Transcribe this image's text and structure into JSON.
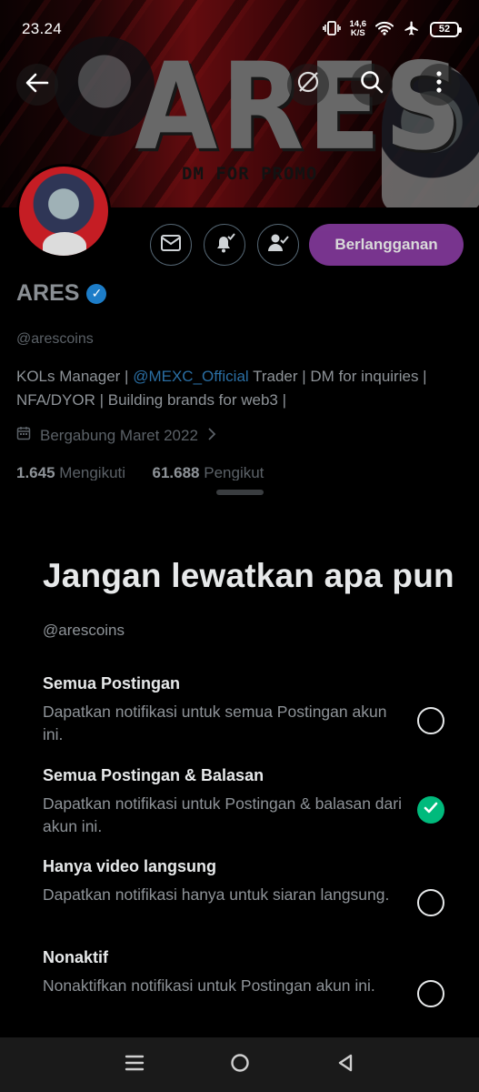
{
  "status_bar": {
    "time": "23.24",
    "net_speed_value": "14,6",
    "net_speed_unit": "K/S",
    "battery": "52"
  },
  "banner": {
    "title": "ARES",
    "subtitle": "DM FOR PROMO"
  },
  "profile": {
    "name": "ARES",
    "handle": "@arescoins",
    "bio_prefix": "KOLs Manager | ",
    "bio_mention": "@MEXC_Official",
    "bio_suffix": " Trader | DM for inquiries | NFA/DYOR | Building brands for web3 |",
    "joined": "Bergabung Maret 2022",
    "following_count": "1.645",
    "following_label": "Mengikuti",
    "followers_count": "61.688",
    "followers_label": "Pengikut",
    "subscribe_label": "Berlangganan"
  },
  "sheet": {
    "title": "Jangan lewatkan apa pun",
    "handle": "@arescoins",
    "options": [
      {
        "title": "Semua Postingan",
        "desc": "Dapatkan notifikasi untuk semua Postingan akun ini.",
        "selected": false
      },
      {
        "title": "Semua Postingan & Balasan",
        "desc": "Dapatkan notifikasi untuk Postingan & balasan dari akun ini.",
        "selected": true
      },
      {
        "title": "Hanya video langsung",
        "desc": "Dapatkan notifikasi hanya untuk siaran langsung.",
        "selected": false
      },
      {
        "title": "Nonaktif",
        "desc": "Nonaktifkan notifikasi untuk Postingan akun ini.",
        "selected": false
      }
    ]
  },
  "colors": {
    "accent_green": "#00ba7c",
    "subscribe_purple": "#8d3ea7",
    "verified_blue": "#1d7dc8",
    "mention_blue": "#2a6ea3"
  },
  "icons": {
    "back": "back-arrow-icon",
    "hide": "eye-off-icon",
    "search": "search-icon",
    "more": "more-vertical-icon",
    "message": "mail-icon",
    "notify": "bell-check-icon",
    "follow": "person-check-icon",
    "calendar": "calendar-icon",
    "chevron": "chevron-right-icon"
  }
}
